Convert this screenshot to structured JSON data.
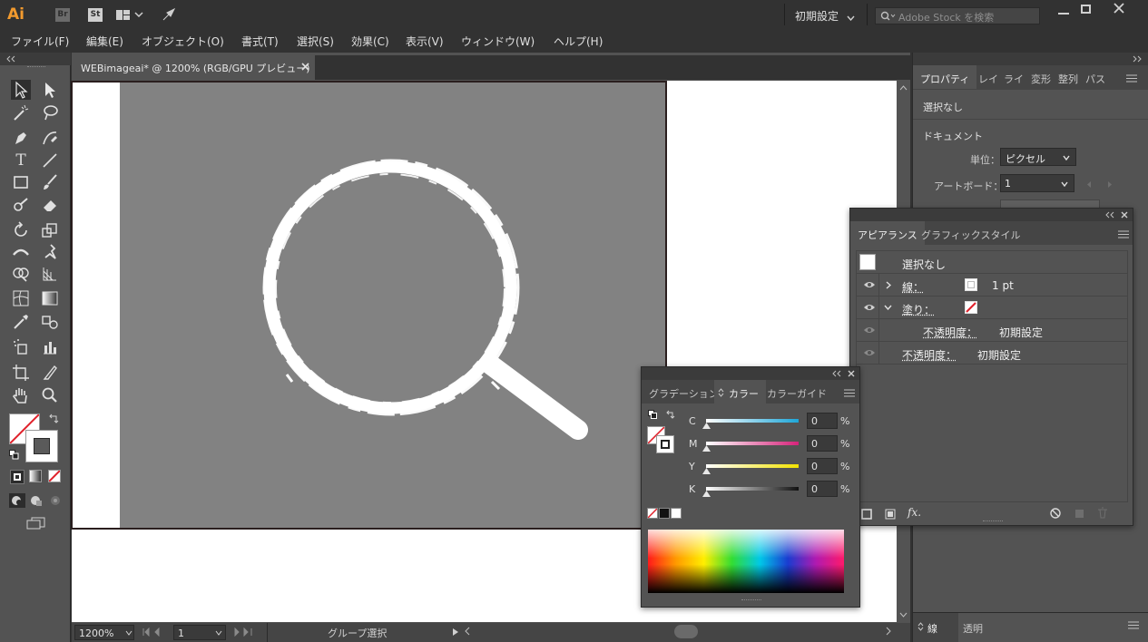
{
  "app": {
    "logo": "Ai",
    "bridge": "Br",
    "stock": "St",
    "workspace": "初期設定",
    "stock_search_placeholder": "Adobe Stock を検索"
  },
  "menu": [
    "ファイル(F)",
    "編集(E)",
    "オブジェクト(O)",
    "書式(T)",
    "選択(S)",
    "効果(C)",
    "表示(V)",
    "ウィンドウ(W)",
    "ヘルプ(H)"
  ],
  "document": {
    "tab_title": "WEBimageai* @ 1200% (RGB/GPU プレビュー)"
  },
  "status": {
    "zoom": "1200%",
    "artboard": "1",
    "tool": "グループ選択"
  },
  "properties": {
    "tabs": [
      "プロパティ",
      "レイ",
      "ライ",
      "変形",
      "整列",
      "パス"
    ],
    "selection": "選択なし",
    "document_heading": "ドキュメント",
    "units_label": "単位：",
    "units_value": "ピクセル",
    "artboard_label": "アートボード：",
    "artboard_value": "1"
  },
  "appearance": {
    "tabs": [
      "アピアランス",
      "グラフィックスタイル"
    ],
    "title": "選択なし",
    "stroke_label": "線：",
    "stroke_value": "1 pt",
    "fill_label": "塗り：",
    "fill_opacity_label": "不透明度：",
    "fill_opacity_value": "初期設定",
    "opacity_label": "不透明度：",
    "opacity_value": "初期設定",
    "fx": "fx."
  },
  "color_panel": {
    "tabs": [
      "グラデーション",
      "カラー",
      "カラーガイド"
    ],
    "channels": [
      {
        "label": "C",
        "value": "0",
        "unit": "%"
      },
      {
        "label": "M",
        "value": "0",
        "unit": "%"
      },
      {
        "label": "Y",
        "value": "0",
        "unit": "%"
      },
      {
        "label": "K",
        "value": "0",
        "unit": "%"
      }
    ]
  },
  "bottom_dock": {
    "tabs": [
      "線",
      "透明"
    ]
  },
  "colors": {
    "accent_cyan": "#1ea6d8",
    "accent_magenta": "#d6237a",
    "accent_yellow": "#f2e200",
    "none_red": "#e0202a"
  }
}
